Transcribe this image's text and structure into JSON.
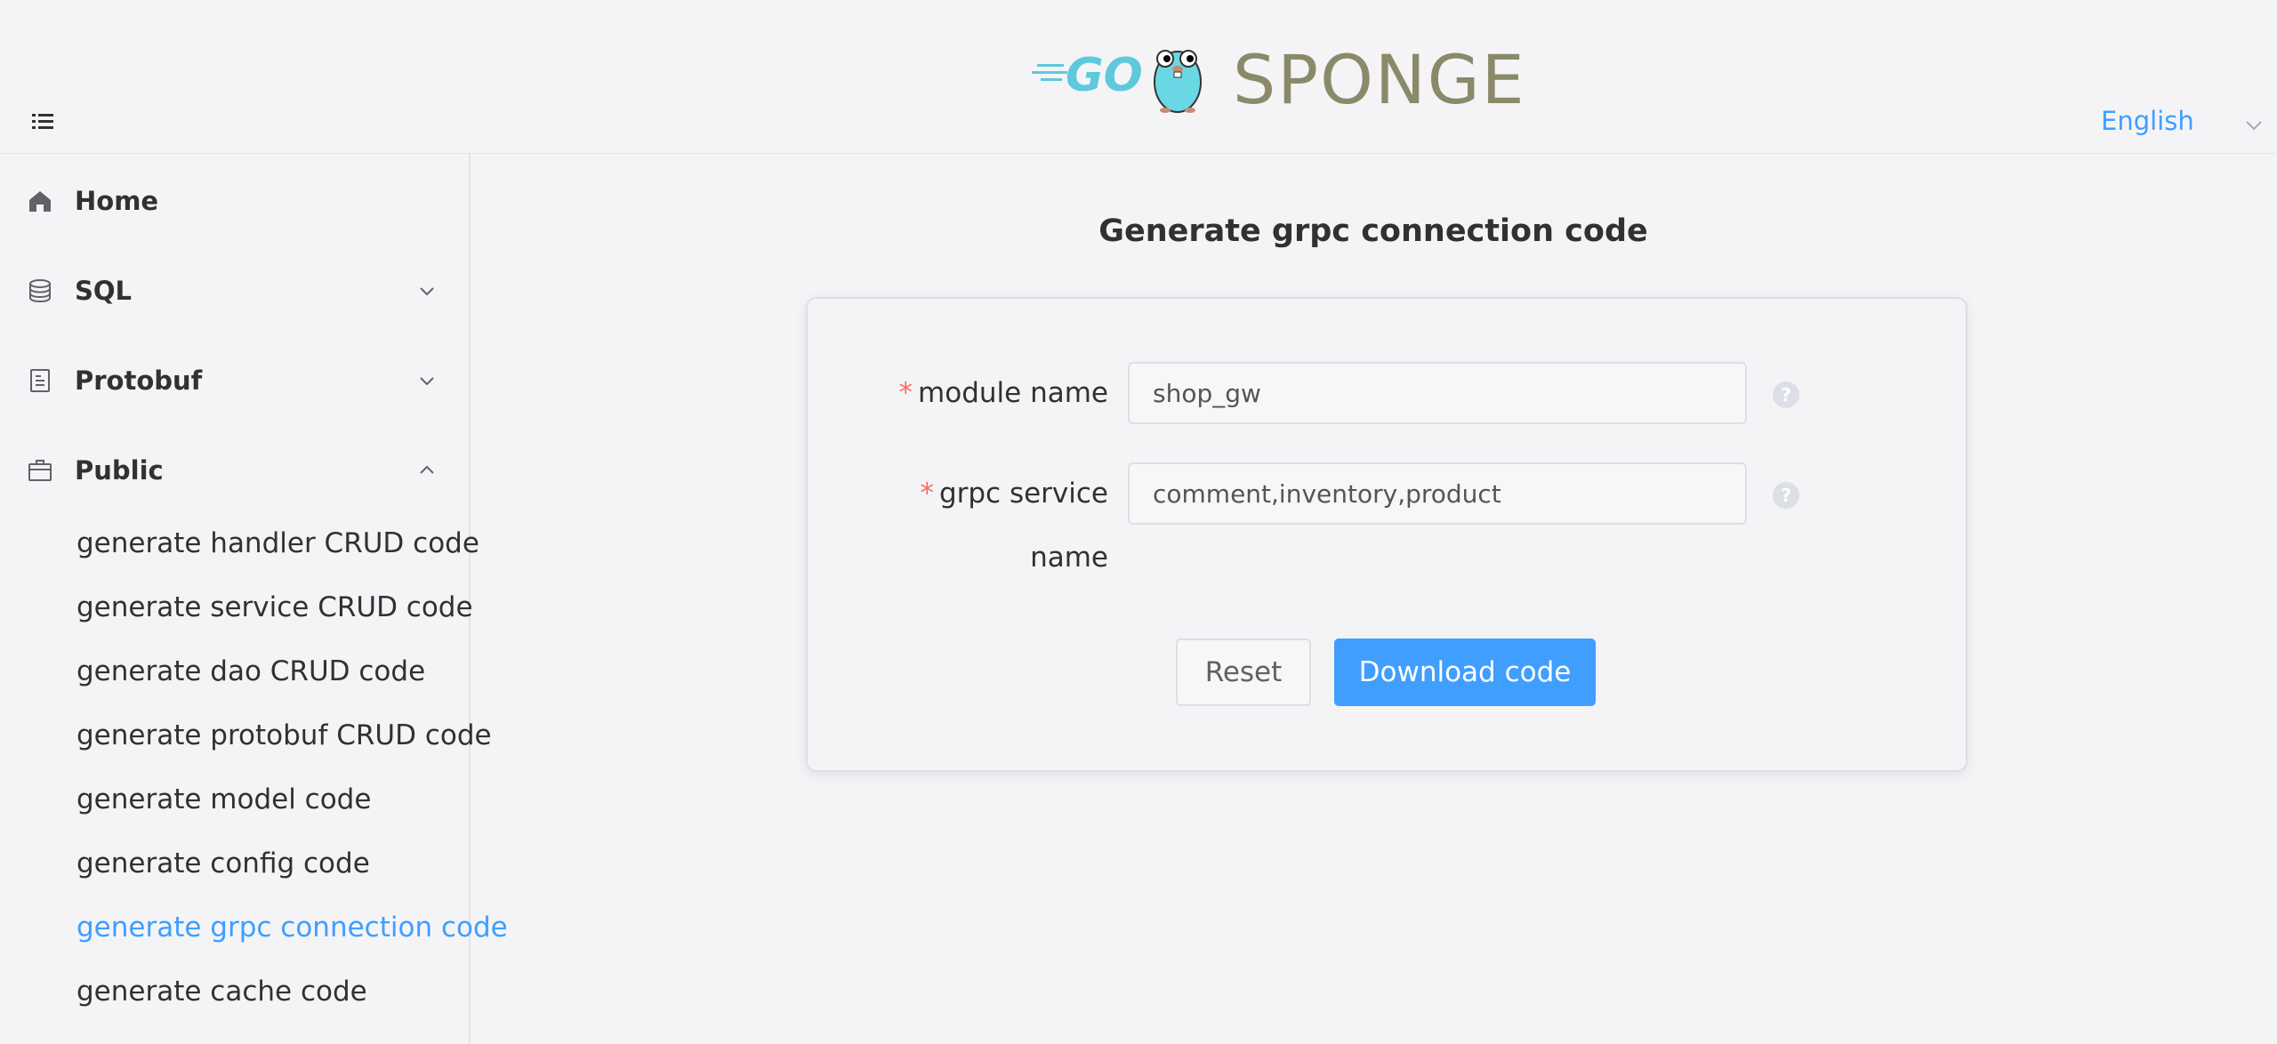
{
  "header": {
    "logo_go_text": "GO",
    "logo_sponge_text": "SPONGE",
    "language": "English"
  },
  "sidebar": {
    "items": [
      {
        "label": "Home",
        "icon": "home-icon"
      },
      {
        "label": "SQL",
        "icon": "database-icon"
      },
      {
        "label": "Protobuf",
        "icon": "document-icon"
      },
      {
        "label": "Public",
        "icon": "briefcase-icon"
      }
    ],
    "public_sub_items": [
      {
        "label": "generate handler CRUD code"
      },
      {
        "label": "generate service CRUD code"
      },
      {
        "label": "generate dao CRUD code"
      },
      {
        "label": "generate protobuf CRUD code"
      },
      {
        "label": "generate model code"
      },
      {
        "label": "generate config code"
      },
      {
        "label": "generate grpc connection code",
        "active": true
      },
      {
        "label": "generate cache code"
      }
    ]
  },
  "main": {
    "title": "Generate grpc connection code",
    "form": {
      "module_name_label": "module name",
      "module_name_value": "shop_gw",
      "grpc_service_label_line1": "grpc service",
      "grpc_service_label_line2": "name",
      "grpc_service_value": "comment,inventory,product",
      "required_mark": "*",
      "reset_label": "Reset",
      "download_label": "Download code"
    }
  },
  "colors": {
    "accent": "#409eff",
    "required": "#f56c6c",
    "background": "#f4f4f6"
  }
}
